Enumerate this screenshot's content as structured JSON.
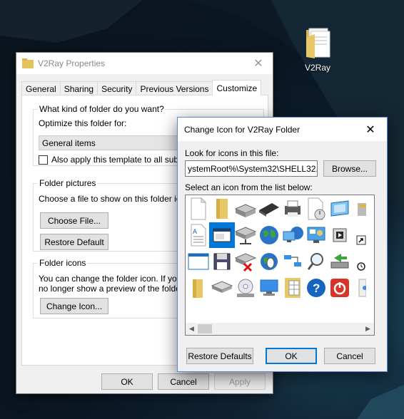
{
  "desktop": {
    "icon_label": "V2Ray"
  },
  "properties": {
    "title": "V2Ray Properties",
    "close_glyph": "✕",
    "tabs": [
      "General",
      "Sharing",
      "Security",
      "Previous Versions",
      "Customize"
    ],
    "active_tab": "Customize",
    "folder_type_group": {
      "label": "What kind of folder do you want?",
      "optimize_label": "Optimize this folder for:",
      "optimize_value": "General items",
      "apply_template_label": "Also apply this template to all subfolders",
      "apply_template_checked": false
    },
    "folder_pictures_group": {
      "label": "Folder pictures",
      "description": "Choose a file to show on this folder icon.",
      "choose_file_button": "Choose File...",
      "restore_default_button": "Restore Default"
    },
    "folder_icons_group": {
      "label": "Folder icons",
      "description_line1": "You can change the folder icon. If you change it, you will",
      "description_line2": "no longer show a preview of the folder's contents.",
      "change_icon_button": "Change Icon..."
    },
    "buttons": {
      "ok": "OK",
      "cancel": "Cancel",
      "apply": "Apply"
    }
  },
  "change_icon_dialog": {
    "title": "Change Icon for V2Ray Folder",
    "close_glyph": "✕",
    "look_for_label": "Look for icons in this file:",
    "file_path": "ystemRoot%\\System32\\SHELL32.dll",
    "browse_button": "Browse...",
    "select_label": "Select an icon from the list below:",
    "icons": [
      [
        "blank-document-icon",
        "folder-icon",
        "disk-drive-icon",
        "memory-chip-icon",
        "printer-icon",
        "scheduled-task-icon",
        "display-settings-icon",
        "partial-icon"
      ],
      [
        "text-document-icon",
        "application-window-icon",
        "network-drive-icon",
        "globe-icon",
        "network-computer-icon",
        "control-panel-icon",
        "media-icon",
        "shortcut-arrow-icon"
      ],
      [
        "window-icon",
        "floppy-disk-icon",
        "disconnected-drive-icon",
        "globe-mouse-icon",
        "network-connection-icon",
        "search-icon",
        "drive-arrow-icon",
        "clock-small-icon"
      ],
      [
        "open-folder-icon",
        "removable-drive-icon",
        "cd-drive-icon",
        "monitor-icon",
        "folder-grid-icon",
        "help-icon",
        "power-icon",
        "partial-icon-2"
      ]
    ],
    "selected_icon": "application-window-icon",
    "buttons": {
      "restore_defaults": "Restore Defaults",
      "ok": "OK",
      "cancel": "Cancel"
    },
    "scroll_left": "◀",
    "scroll_right": "▶"
  }
}
